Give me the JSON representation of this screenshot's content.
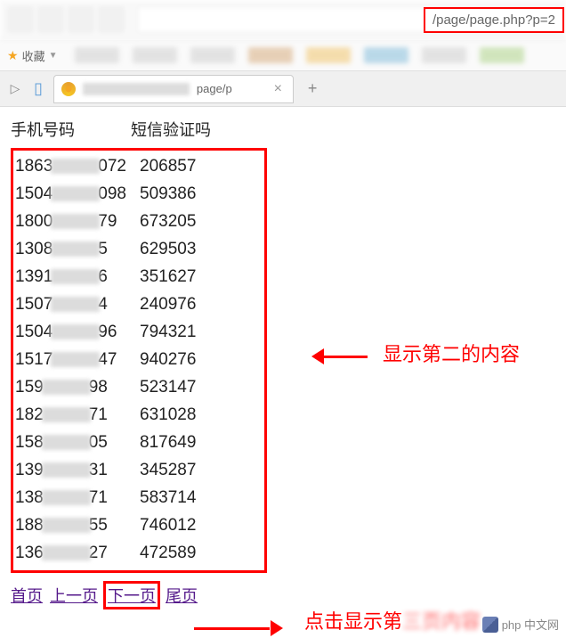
{
  "url_visible_part": "/page/page.php?p=2",
  "favorites_label": "收藏",
  "tab": {
    "title_visible": "page/p",
    "close_icon": "×",
    "new_tab_icon": "+"
  },
  "headers": {
    "phone": "手机号码",
    "code": "短信验证吗"
  },
  "rows": [
    {
      "phone_prefix": "1863",
      "phone_suffix": "072",
      "code": "206857"
    },
    {
      "phone_prefix": "1504",
      "phone_suffix": "098",
      "code": "509386"
    },
    {
      "phone_prefix": "1800",
      "phone_suffix": "79",
      "code": "673205"
    },
    {
      "phone_prefix": "1308",
      "phone_suffix": "5",
      "code": "629503"
    },
    {
      "phone_prefix": "1391",
      "phone_suffix": "6",
      "code": "351627"
    },
    {
      "phone_prefix": "1507",
      "phone_suffix": "4",
      "code": "240976"
    },
    {
      "phone_prefix": "1504",
      "phone_suffix": "96",
      "code": "794321"
    },
    {
      "phone_prefix": "1517",
      "phone_suffix": "47",
      "code": "940276"
    },
    {
      "phone_prefix": "159",
      "phone_suffix": "98",
      "code": "523147"
    },
    {
      "phone_prefix": "182",
      "phone_suffix": "71",
      "code": "631028"
    },
    {
      "phone_prefix": "158",
      "phone_suffix": "05",
      "code": "817649"
    },
    {
      "phone_prefix": "139",
      "phone_suffix": "31",
      "code": "345287"
    },
    {
      "phone_prefix": "138",
      "phone_suffix": "71",
      "code": "583714"
    },
    {
      "phone_prefix": "188",
      "phone_suffix": "55",
      "code": "746012"
    },
    {
      "phone_prefix": "136",
      "phone_suffix": "27",
      "code": "472589"
    }
  ],
  "pagination": {
    "first": "首页",
    "prev": "上一页",
    "next": "下一页",
    "last": "尾页"
  },
  "annotations": {
    "right_text": "显示第二的内容",
    "bottom_text": "点击显示第",
    "bottom_text_blur": "三页内容"
  },
  "watermark": "php 中文网"
}
